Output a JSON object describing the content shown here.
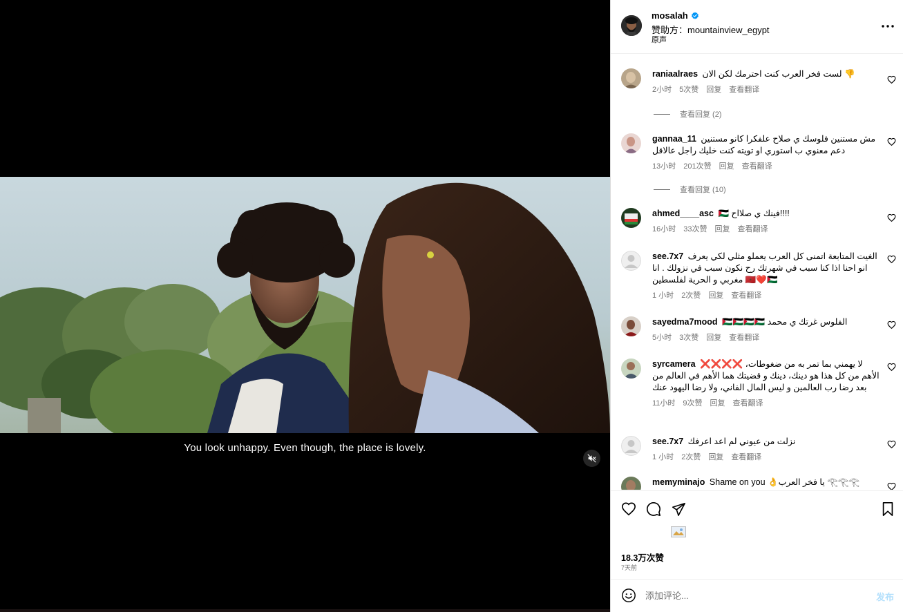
{
  "video": {
    "subtitle": "You look unhappy. Even though, the place is lovely.",
    "mute_icon": "speaker-muted-icon"
  },
  "header": {
    "username": "mosalah",
    "verified_icon": "verified-badge-icon",
    "sponsor_prefix": "赞助方：",
    "sponsor_name": "mountainview_egypt",
    "audio": "原声",
    "more_icon": "more-options-icon"
  },
  "comments": [
    {
      "user": "raniaalraes",
      "text": "لست فخر العرب كنت احترمك لكن الان 👎",
      "time": "2小时",
      "likes": "5次赞",
      "reply": "回复",
      "translate": "查看翻译",
      "view_replies": "查看回复 (2)"
    },
    {
      "user": "gannaa_11",
      "text": "مش مستنين فلوسك ي صلاح علفكرا كانو مستنين دعم معنوي ب استوري او تويته كنت خليك راجل عالاقل",
      "time": "13小时",
      "likes": "201次赞",
      "reply": "回复",
      "translate": "查看翻译",
      "view_replies": "查看回复 (10)"
    },
    {
      "user": "ahmed____asc",
      "text": "🇵🇸 فينك ي صلااح!!!!",
      "time": "16小时",
      "likes": "33次赞",
      "reply": "回复",
      "translate": "查看翻译"
    },
    {
      "user": "see.7x7",
      "text": "الغيت المتابعة اتمنى كل العرب يعملو مثلي لكي يعرف انو احنا اذا كنا سبب في شهرتك رح نكون سبب في نزولك . انا مغربي و الحرية لفلسطين 🇲🇦❤️🇵🇸",
      "time": "1 小时",
      "likes": "2次赞",
      "reply": "回复",
      "translate": "查看翻译"
    },
    {
      "user": "sayedma7mood",
      "text": "🇵🇸🇵🇸🇵🇸🇵🇸 الفلوس غرتك ي محمد",
      "time": "5小时",
      "likes": "3次赞",
      "reply": "回复",
      "translate": "查看翻译"
    },
    {
      "user": "syrcamera",
      "text": "❌❌❌❌ لا يهمني بما تمر به من ضغوطات، الأهم من كل هذا هو دينك، دينك و قضيتك هما الأهم في العالم من بعد رضا رب العالمين و ليس المال الفاني، ولا رضا اليهود عنك",
      "time": "11小时",
      "likes": "9次赞",
      "reply": "回复",
      "translate": "查看翻译"
    },
    {
      "user": "see.7x7",
      "text": "نزلت من عيوني لم اعد اعرفك",
      "time": "1 小时",
      "likes": "2次赞",
      "reply": "回复",
      "translate": "查看翻译"
    },
    {
      "user": "memyminajo",
      "text": "Shame on you 👌يا فخر العرب 𓂀𓂀𓂀"
    }
  ],
  "actions": {
    "like_icon": "heart-icon",
    "comment_icon": "comment-bubble-icon",
    "share_icon": "paper-plane-icon",
    "save_icon": "bookmark-icon"
  },
  "likes": "18.3万次赞",
  "posted_ago": "7天前",
  "add_comment": {
    "placeholder": "添加评论...",
    "post_label": "发布",
    "emoji_icon": "emoji-smile-icon"
  },
  "colors": {
    "secondary_text": "#737373",
    "post_button_disabled": "#b2dffc",
    "verified_blue": "#0095f6"
  }
}
